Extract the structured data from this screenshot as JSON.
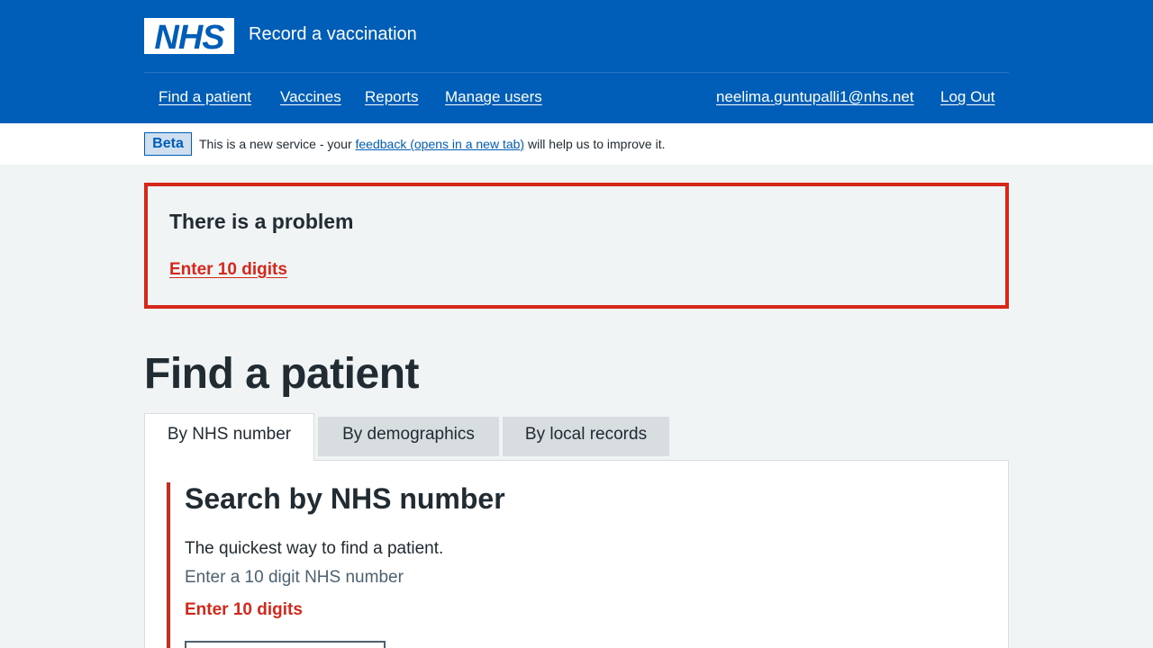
{
  "header": {
    "logo_text": "NHS",
    "service_name": "Record a vaccination",
    "nav": {
      "find_patient": "Find a patient",
      "vaccines": "Vaccines",
      "reports": "Reports",
      "manage_users": "Manage users",
      "user_email": "neelima.guntupalli1@nhs.net",
      "log_out": "Log Out"
    }
  },
  "beta": {
    "tag": "Beta",
    "text_before": "This is a new service - your ",
    "link": "feedback (opens in a new tab)",
    "text_after": " will help us to improve it."
  },
  "error_summary": {
    "title": "There is a problem",
    "link": "Enter 10 digits"
  },
  "page_title": "Find a patient",
  "tabs": {
    "nhs_number": "By NHS number",
    "demographics": "By demographics",
    "local_records": "By local records"
  },
  "panel": {
    "title": "Search by NHS number",
    "text": "The quickest way to find a patient.",
    "hint": "Enter a 10 digit NHS number",
    "error": "Enter 10 digits",
    "input_value": ""
  },
  "colors": {
    "nhs_blue": "#005eb8",
    "error_red": "#d5281b",
    "background": "#f0f4f5"
  }
}
